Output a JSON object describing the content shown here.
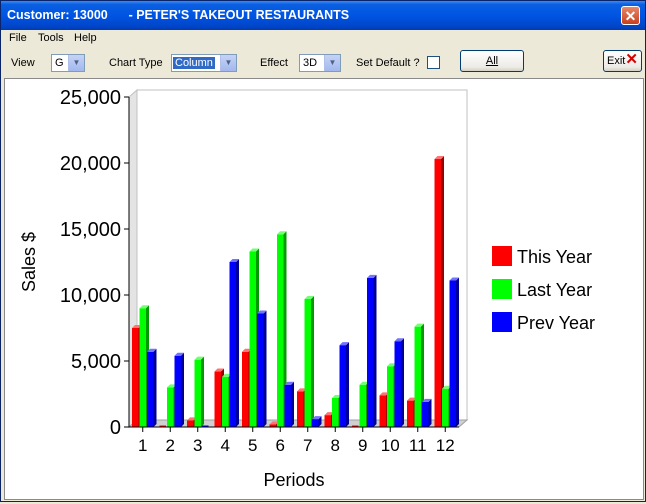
{
  "window": {
    "title": "Customer: 13000      - PETER'S TAKEOUT RESTAURANTS",
    "close_label": "✕"
  },
  "menu": {
    "items": [
      "File",
      "Tools",
      "Help"
    ]
  },
  "toolbar": {
    "view_label": "View",
    "view_value": "G",
    "chart_type_label": "Chart Type",
    "chart_type_value": "Column",
    "effect_label": "Effect",
    "effect_value": "3D",
    "set_default_label": "Set Default ?",
    "set_default_checked": false,
    "all_label": "All",
    "exit_label": "Exit"
  },
  "colors": {
    "this_year": "#ff0000",
    "last_year": "#00ff00",
    "prev_year": "#0000ff",
    "titlebar": "#0054e3"
  },
  "chart_data": {
    "type": "bar",
    "effect": "3D",
    "categories": [
      "1",
      "2",
      "3",
      "4",
      "5",
      "6",
      "7",
      "8",
      "9",
      "10",
      "11",
      "12"
    ],
    "series": [
      {
        "name": "This Year",
        "color": "#ff0000",
        "values": [
          7500,
          0,
          500,
          4200,
          5700,
          200,
          2700,
          900,
          0,
          2400,
          2000,
          20300
        ]
      },
      {
        "name": "Last Year",
        "color": "#00ff00",
        "values": [
          9000,
          3000,
          5100,
          3800,
          13300,
          14600,
          9700,
          2200,
          3200,
          4600,
          7600,
          2900
        ]
      },
      {
        "name": "Prev Year",
        "color": "#0000ff",
        "values": [
          5700,
          5400,
          0,
          12500,
          8600,
          3200,
          600,
          6200,
          11300,
          6500,
          1900,
          11100
        ]
      }
    ],
    "ylim": [
      0,
      25000
    ],
    "yticks": [
      "0",
      "5,000",
      "10,000",
      "15,000",
      "20,000",
      "25,000"
    ],
    "xlabel": "Periods",
    "ylabel": "Sales $",
    "legend_position": "right"
  }
}
